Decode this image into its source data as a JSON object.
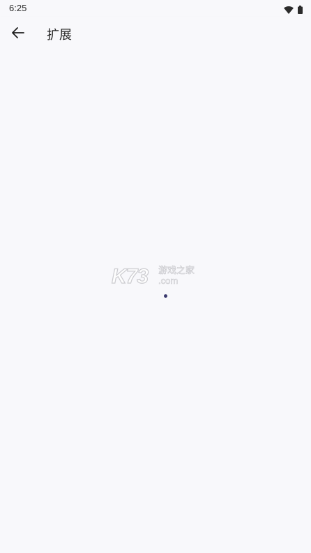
{
  "status_bar": {
    "time": "6:25",
    "icons": [
      "wifi-icon",
      "battery-icon"
    ]
  },
  "app_bar": {
    "back_icon": "arrow-left-icon",
    "title": "扩展"
  },
  "content": {
    "watermark": {
      "brand": "K73",
      "subtitle": "游戏之家",
      "domain": ".com"
    },
    "loading_indicator_color": "#3b3a6e"
  },
  "colors": {
    "background": "#f8f8fb",
    "text_primary": "#1e1e1e"
  }
}
